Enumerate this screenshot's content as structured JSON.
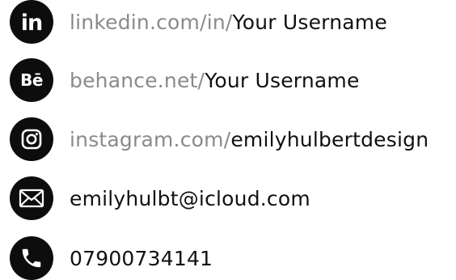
{
  "contacts": {
    "linkedin": {
      "icon": "linkedin-icon",
      "icon_text": "in",
      "prefix": "linkedin.com/in/",
      "value": "Your Username"
    },
    "behance": {
      "icon": "behance-icon",
      "icon_text": "Bē",
      "prefix": "behance.net/",
      "value": "Your Username"
    },
    "instagram": {
      "icon": "instagram-icon",
      "prefix": "instagram.com/",
      "value": "emilyhulbertdesign"
    },
    "email": {
      "icon": "envelope-icon",
      "value": "emilyhulbt@icloud.com"
    },
    "phone": {
      "icon": "phone-icon",
      "value": "07900734141"
    }
  },
  "colors": {
    "icon_background": "#0d0d0d",
    "prefix_text": "#8a8a8a",
    "value_text": "#111111"
  }
}
